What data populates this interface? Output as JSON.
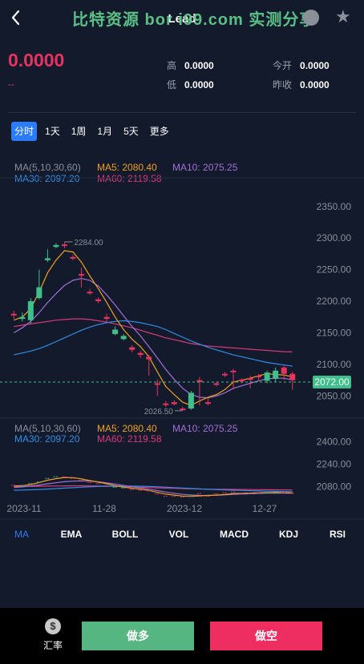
{
  "header": {
    "back_icon": "chevron-left-icon",
    "title": "Lead",
    "watermark": "比特资源 bor i99.com 实测分享",
    "star_icon": "star-icon"
  },
  "quote": {
    "price": "0.0000",
    "change": "--",
    "high_label": "高",
    "high": "0.0000",
    "low_label": "低",
    "low": "0.0000",
    "open_label": "今开",
    "open": "0.0000",
    "prev_label": "昨收",
    "prev": "0.0000"
  },
  "period_tabs": [
    "分时",
    "1天",
    "1周",
    "1月",
    "5天",
    "更多"
  ],
  "active_period": "分时",
  "ma_legend": {
    "params": "MA(5,10,30,60)",
    "ma5": "MA5: 2080.40",
    "ma10": "MA10: 2075.25",
    "ma30": "MA30: 2097.20",
    "ma60": "MA60: 2119.58"
  },
  "colors": {
    "up": "#3fbf8a",
    "down": "#e8325f",
    "ma5": "#f0a020",
    "ma10": "#a070d8",
    "ma30": "#2f8ee8",
    "ma60": "#d93a7a",
    "accent": "#2b7cf6"
  },
  "chart_data": [
    {
      "type": "candlestick",
      "y_ticks": [
        "2350.00",
        "2300.00",
        "2250.00",
        "2200.00",
        "2150.00",
        "2100.00",
        "2050.00"
      ],
      "ylim": [
        2025,
        2365
      ],
      "high_marker": "2284.00",
      "low_marker": "2026.50",
      "last_price": "2072.00",
      "candles": [
        {
          "o": 2180,
          "c": 2178,
          "h": 2185,
          "l": 2172
        },
        {
          "o": 2172,
          "c": 2175,
          "h": 2182,
          "l": 2168
        },
        {
          "o": 2170,
          "c": 2200,
          "h": 2205,
          "l": 2165
        },
        {
          "o": 2205,
          "c": 2222,
          "h": 2250,
          "l": 2203
        },
        {
          "o": 2265,
          "c": 2268,
          "h": 2282,
          "l": 2262
        },
        {
          "o": 2286,
          "c": 2289,
          "h": 2292,
          "l": 2284
        },
        {
          "o": 2290,
          "c": 2288,
          "h": 2294,
          "l": 2284
        },
        {
          "o": 2270,
          "c": 2268,
          "h": 2273,
          "l": 2265
        },
        {
          "o": 2243,
          "c": 2242,
          "h": 2253,
          "l": 2222
        },
        {
          "o": 2215,
          "c": 2213,
          "h": 2220,
          "l": 2210
        },
        {
          "o": 2203,
          "c": 2200,
          "h": 2206,
          "l": 2197
        },
        {
          "o": 2175,
          "c": 2172,
          "h": 2180,
          "l": 2168
        },
        {
          "o": 2148,
          "c": 2155,
          "h": 2160,
          "l": 2146
        },
        {
          "o": 2140,
          "c": 2145,
          "h": 2148,
          "l": 2138
        },
        {
          "o": 2127,
          "c": 2123,
          "h": 2130,
          "l": 2119
        },
        {
          "o": 2118,
          "c": 2115,
          "h": 2122,
          "l": 2110
        },
        {
          "o": 2112,
          "c": 2108,
          "h": 2115,
          "l": 2082
        },
        {
          "o": 2070,
          "c": 2068,
          "h": 2076,
          "l": 2050
        },
        {
          "o": 2038,
          "c": 2036,
          "h": 2042,
          "l": 2032
        },
        {
          "o": 2040,
          "c": 2037,
          "h": 2043,
          "l": 2035
        },
        {
          "o": 2030,
          "c": 2028,
          "h": 2033,
          "l": 2026.5
        },
        {
          "o": 2030,
          "c": 2055,
          "h": 2058,
          "l": 2028
        },
        {
          "o": 2075,
          "c": 2072,
          "h": 2080,
          "l": 2035
        },
        {
          "o": 2040,
          "c": 2038,
          "h": 2046,
          "l": 2035
        },
        {
          "o": 2070,
          "c": 2068,
          "h": 2072,
          "l": 2065
        },
        {
          "o": 2085,
          "c": 2083,
          "h": 2088,
          "l": 2080
        },
        {
          "o": 2090,
          "c": 2088,
          "h": 2093,
          "l": 2060
        },
        {
          "o": 2076,
          "c": 2073,
          "h": 2078,
          "l": 2070
        },
        {
          "o": 2078,
          "c": 2076,
          "h": 2082,
          "l": 2062
        },
        {
          "o": 2082,
          "c": 2080,
          "h": 2085,
          "l": 2073
        },
        {
          "o": 2074,
          "c": 2087,
          "h": 2090,
          "l": 2070
        },
        {
          "o": 2077,
          "c": 2090,
          "h": 2095,
          "l": 2072
        },
        {
          "o": 2095,
          "c": 2085,
          "h": 2098,
          "l": 2075
        },
        {
          "o": 2085,
          "c": 2075,
          "h": 2088,
          "l": 2060
        }
      ],
      "ma5": [
        2170,
        2175,
        2188,
        2215,
        2245,
        2265,
        2280,
        2278,
        2262,
        2240,
        2220,
        2198,
        2175,
        2155,
        2140,
        2128,
        2112,
        2088,
        2065,
        2052,
        2040,
        2035,
        2042,
        2048,
        2052,
        2060,
        2072,
        2075,
        2078,
        2082,
        2085,
        2084,
        2083,
        2080.4
      ],
      "ma10": [
        2150,
        2158,
        2168,
        2182,
        2198,
        2212,
        2225,
        2233,
        2236,
        2233,
        2224,
        2210,
        2194,
        2177,
        2160,
        2145,
        2128,
        2110,
        2092,
        2076,
        2062,
        2052,
        2048,
        2047,
        2050,
        2055,
        2062,
        2066,
        2070,
        2074,
        2077,
        2078,
        2078,
        2075.25
      ],
      "ma30": [
        2115,
        2118,
        2121,
        2125,
        2130,
        2136,
        2142,
        2148,
        2154,
        2159,
        2163,
        2166,
        2168,
        2169,
        2168,
        2166,
        2163,
        2160,
        2155,
        2149,
        2143,
        2137,
        2132,
        2127,
        2123,
        2119,
        2115,
        2112,
        2109,
        2106,
        2103,
        2101,
        2099,
        2097.2
      ],
      "ma60": [
        2160,
        2162,
        2164,
        2166,
        2168,
        2170,
        2171,
        2172,
        2172,
        2171,
        2169,
        2167,
        2164,
        2161,
        2158,
        2154,
        2150,
        2146,
        2142,
        2139,
        2136,
        2133,
        2131,
        2129,
        2128,
        2127,
        2126,
        2125,
        2124,
        2123,
        2122,
        2121,
        2120,
        2119.58
      ]
    },
    {
      "type": "line",
      "y_ticks": [
        "2400.00",
        "2240.00",
        "2080.00"
      ],
      "ylim": [
        2010,
        2420
      ],
      "x_labels": [
        "2023-11",
        "11-28",
        "2023-12",
        "12-27"
      ]
    }
  ],
  "indicator_tabs": [
    "MA",
    "EMA",
    "BOLL",
    "VOL",
    "MACD",
    "KDJ",
    "RSI"
  ],
  "active_indicator": "MA",
  "footer": {
    "rate_icon": "dollar-icon",
    "rate_glyph": "$",
    "rate_label": "汇率",
    "long_label": "做多",
    "short_label": "做空"
  }
}
